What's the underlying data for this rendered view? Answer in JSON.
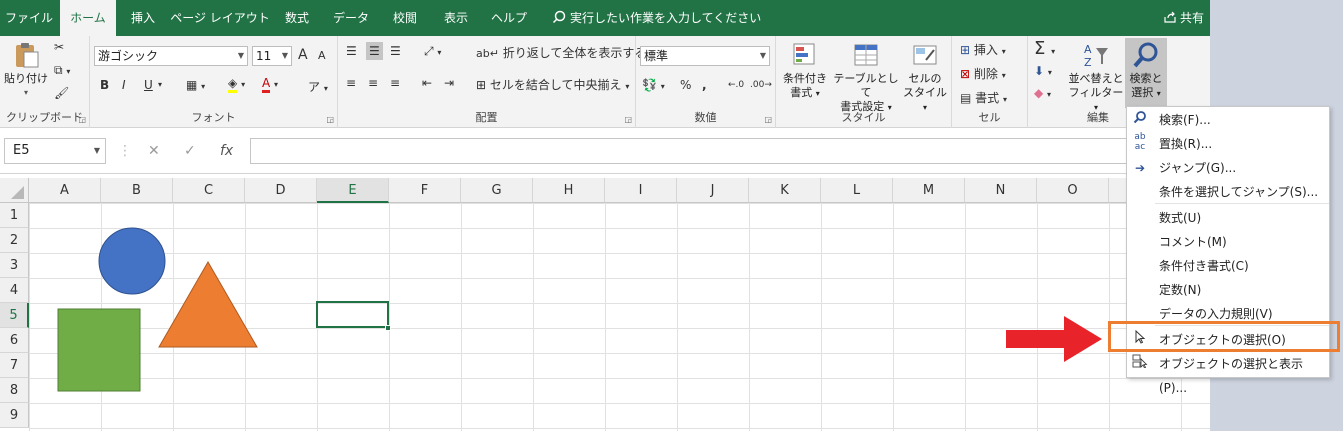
{
  "tabs": [
    {
      "label": "ファイル",
      "active": false
    },
    {
      "label": "ホーム",
      "active": true
    },
    {
      "label": "挿入",
      "active": false
    },
    {
      "label": "ページ レイアウト",
      "active": false
    },
    {
      "label": "数式",
      "active": false
    },
    {
      "label": "データ",
      "active": false
    },
    {
      "label": "校閲",
      "active": false
    },
    {
      "label": "表示",
      "active": false
    },
    {
      "label": "ヘルプ",
      "active": false
    }
  ],
  "tell_me": "実行したい作業を入力してください",
  "share": "共有",
  "ribbon": {
    "clipboard": {
      "label": "クリップボード",
      "paste": "貼り付け"
    },
    "font": {
      "label": "フォント",
      "font_name": "游ゴシック",
      "font_size": "11",
      "bold": "B",
      "italic": "I",
      "underline": "U",
      "grow": "A",
      "shrink": "A",
      "font_color": "A"
    },
    "alignment": {
      "label": "配置",
      "wrap": "折り返して全体を表示する",
      "merge": "セルを結合して中央揃え"
    },
    "number": {
      "label": "数値",
      "format": "標準",
      "percent": "%",
      "comma": ","
    },
    "styles": {
      "label": "スタイル",
      "cond_format": [
        "条件付き",
        "書式"
      ],
      "table_format": [
        "テーブルとして",
        "書式設定"
      ],
      "cell_styles": [
        "セルの",
        "スタイル"
      ]
    },
    "cells": {
      "label": "セル",
      "insert": "挿入",
      "delete": "削除",
      "format": "書式"
    },
    "editing": {
      "label": "編集",
      "sort": [
        "並べ替えと",
        "フィルター"
      ],
      "find": [
        "検索と",
        "選択"
      ]
    }
  },
  "formula_bar": {
    "name_box": "E5",
    "cancel": "✕",
    "enter": "✓",
    "fx": "fx"
  },
  "columns": [
    "A",
    "B",
    "C",
    "D",
    "E",
    "F",
    "G",
    "H",
    "I",
    "J",
    "K",
    "L",
    "M",
    "N",
    "O"
  ],
  "rows": [
    "1",
    "2",
    "3",
    "4",
    "5",
    "6",
    "7",
    "8",
    "9"
  ],
  "active_cell": {
    "column": "E",
    "row": "5"
  },
  "shapes": {
    "circle_color": "#4472c4",
    "triangle_color": "#ed7d31",
    "square_color": "#70ad47"
  },
  "menu": {
    "items": [
      {
        "label": "検索(F)...",
        "icon": "search-icon"
      },
      {
        "label": "置換(R)...",
        "icon": "replace-icon"
      },
      {
        "label": "ジャンプ(G)...",
        "icon": "arrow-right-icon"
      },
      {
        "label": "条件を選択してジャンプ(S)...",
        "icon": ""
      },
      {
        "label": "数式(U)",
        "icon": ""
      },
      {
        "label": "コメント(M)",
        "icon": ""
      },
      {
        "label": "条件付き書式(C)",
        "icon": ""
      },
      {
        "label": "定数(N)",
        "icon": ""
      },
      {
        "label": "データの入力規則(V)",
        "icon": ""
      },
      {
        "label": "オブジェクトの選択(O)",
        "icon": "pointer-icon"
      },
      {
        "label": "オブジェクトの選択と表示(P)...",
        "icon": "selection-pane-icon"
      }
    ]
  },
  "colors": {
    "excel_green": "#217346",
    "highlight": "#ed7d31",
    "arrow": "#e8232a"
  }
}
